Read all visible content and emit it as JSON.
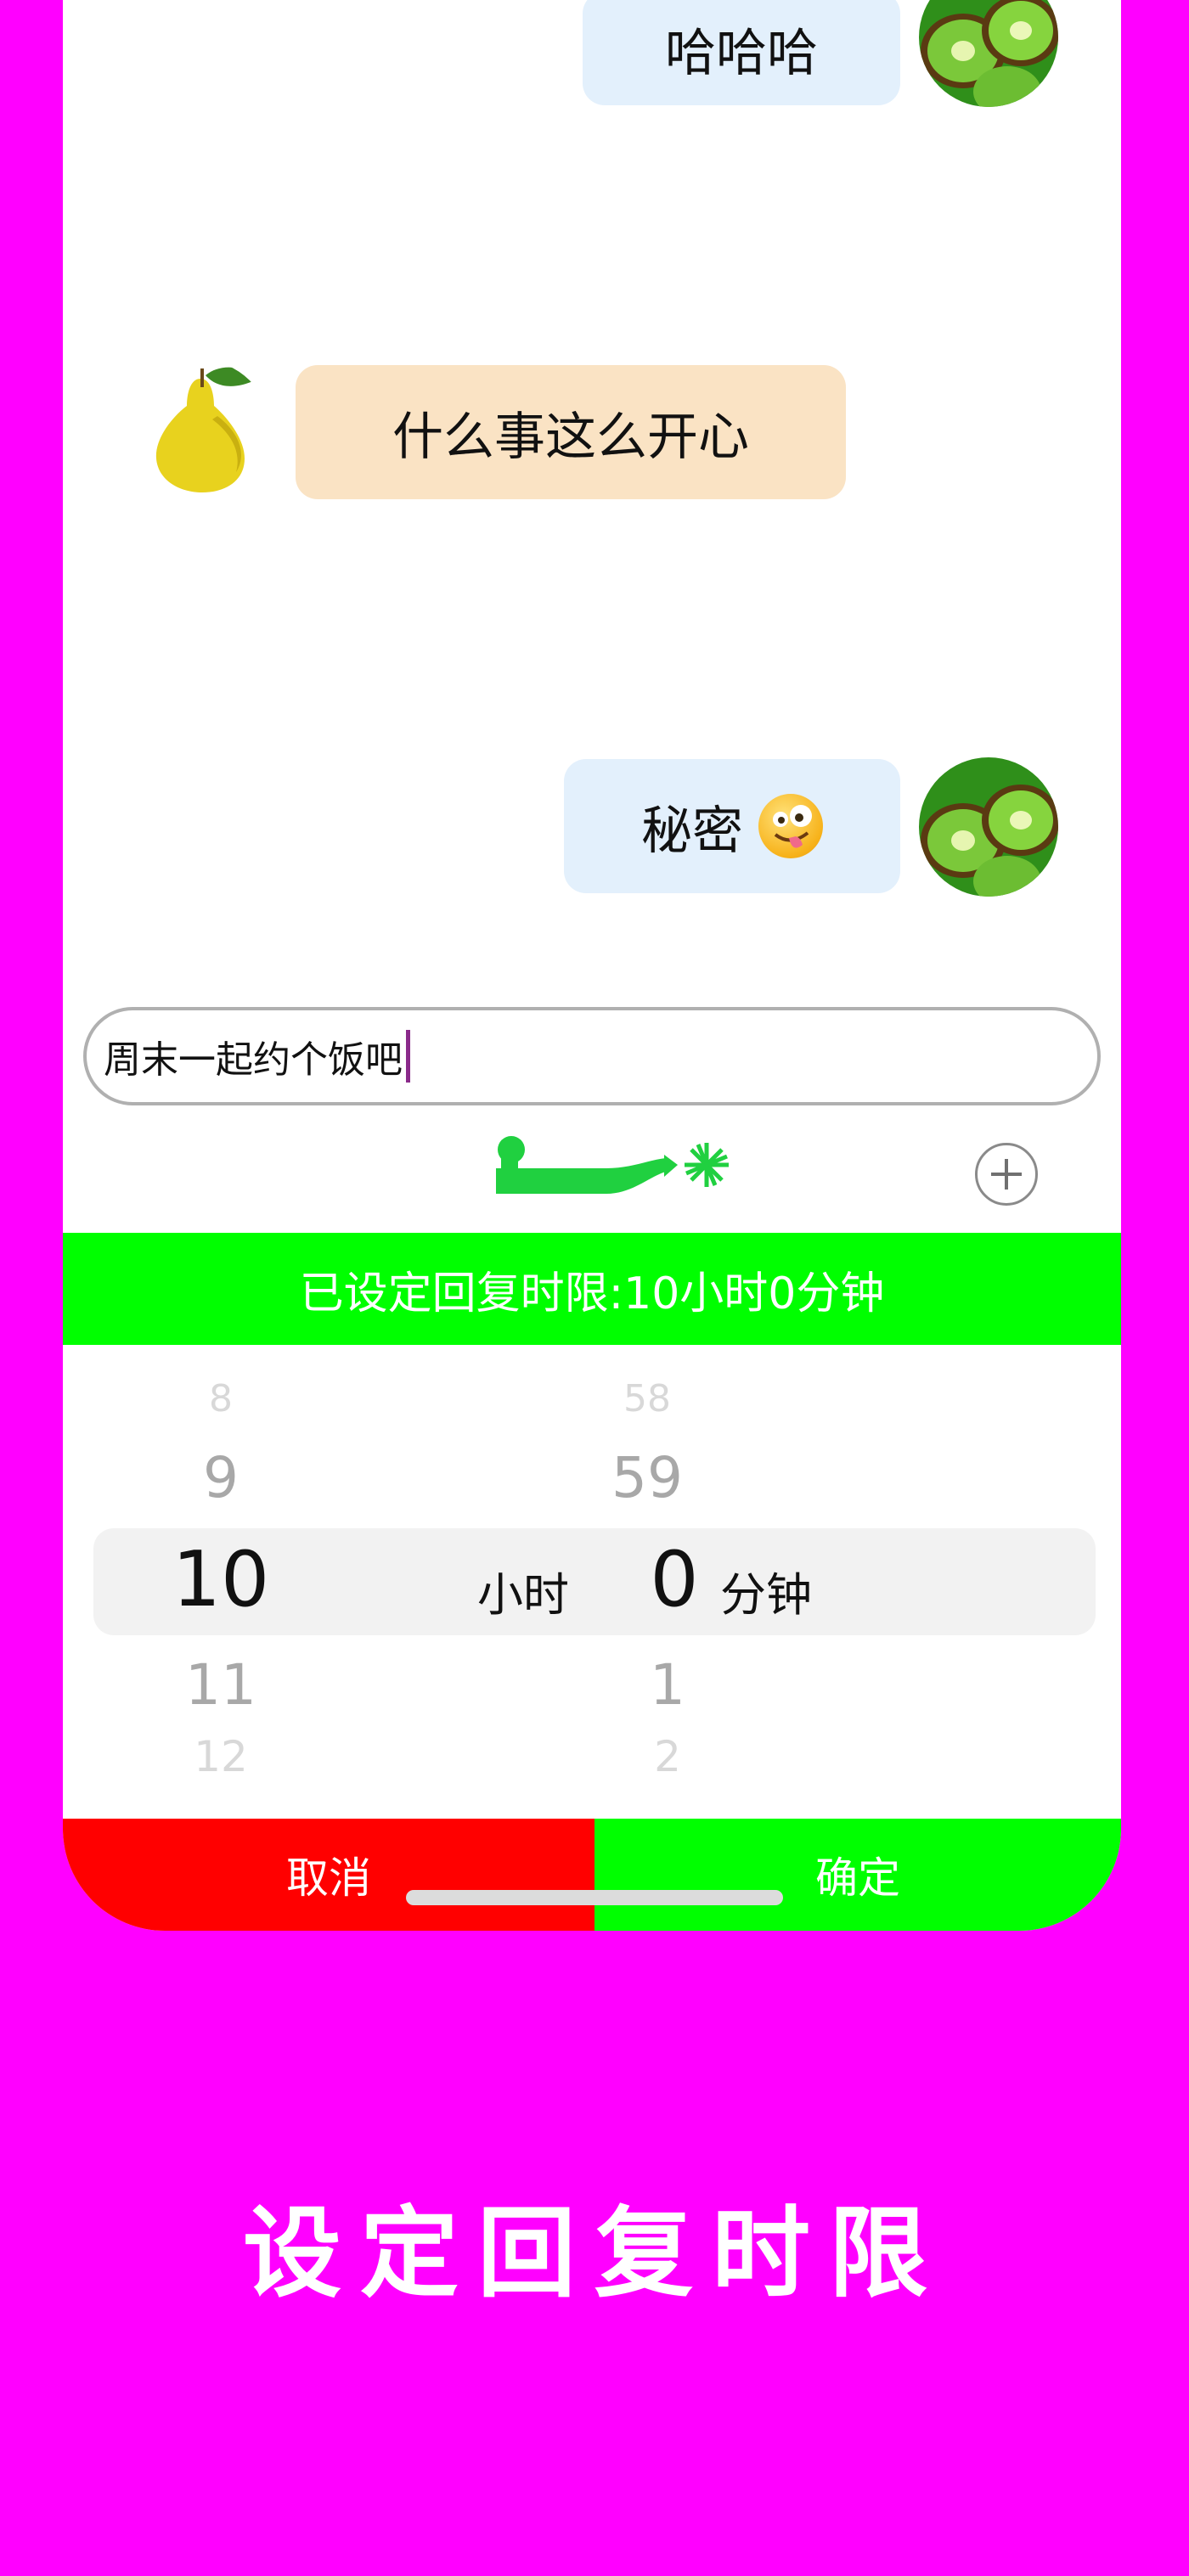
{
  "chat": {
    "messages": [
      {
        "sender": "me",
        "text": "哈哈哈"
      },
      {
        "sender": "other",
        "text": "什么事这么开心"
      },
      {
        "sender": "me",
        "text": "秘密"
      }
    ]
  },
  "input": {
    "value": "周末一起约个饭吧"
  },
  "reply_limit": {
    "status_text": "已设定回复时限:10小时0分钟"
  },
  "picker": {
    "hours": {
      "above2": "8",
      "above1": "9",
      "selected": "10",
      "below1": "11",
      "below2": "12",
      "unit": "小时"
    },
    "minutes": {
      "above2": "58",
      "above1": "59",
      "selected": "0",
      "below1": "1",
      "below2": "2",
      "unit": "分钟"
    }
  },
  "actions": {
    "cancel_label": "取消",
    "confirm_label": "确定"
  },
  "caption": "设定回复时限",
  "colors": {
    "background": "#ff00ff",
    "accent_green": "#00ff00",
    "cancel_red": "#ff0000",
    "my_bubble": "#e3f0fc",
    "other_bubble": "#fae3c4"
  }
}
